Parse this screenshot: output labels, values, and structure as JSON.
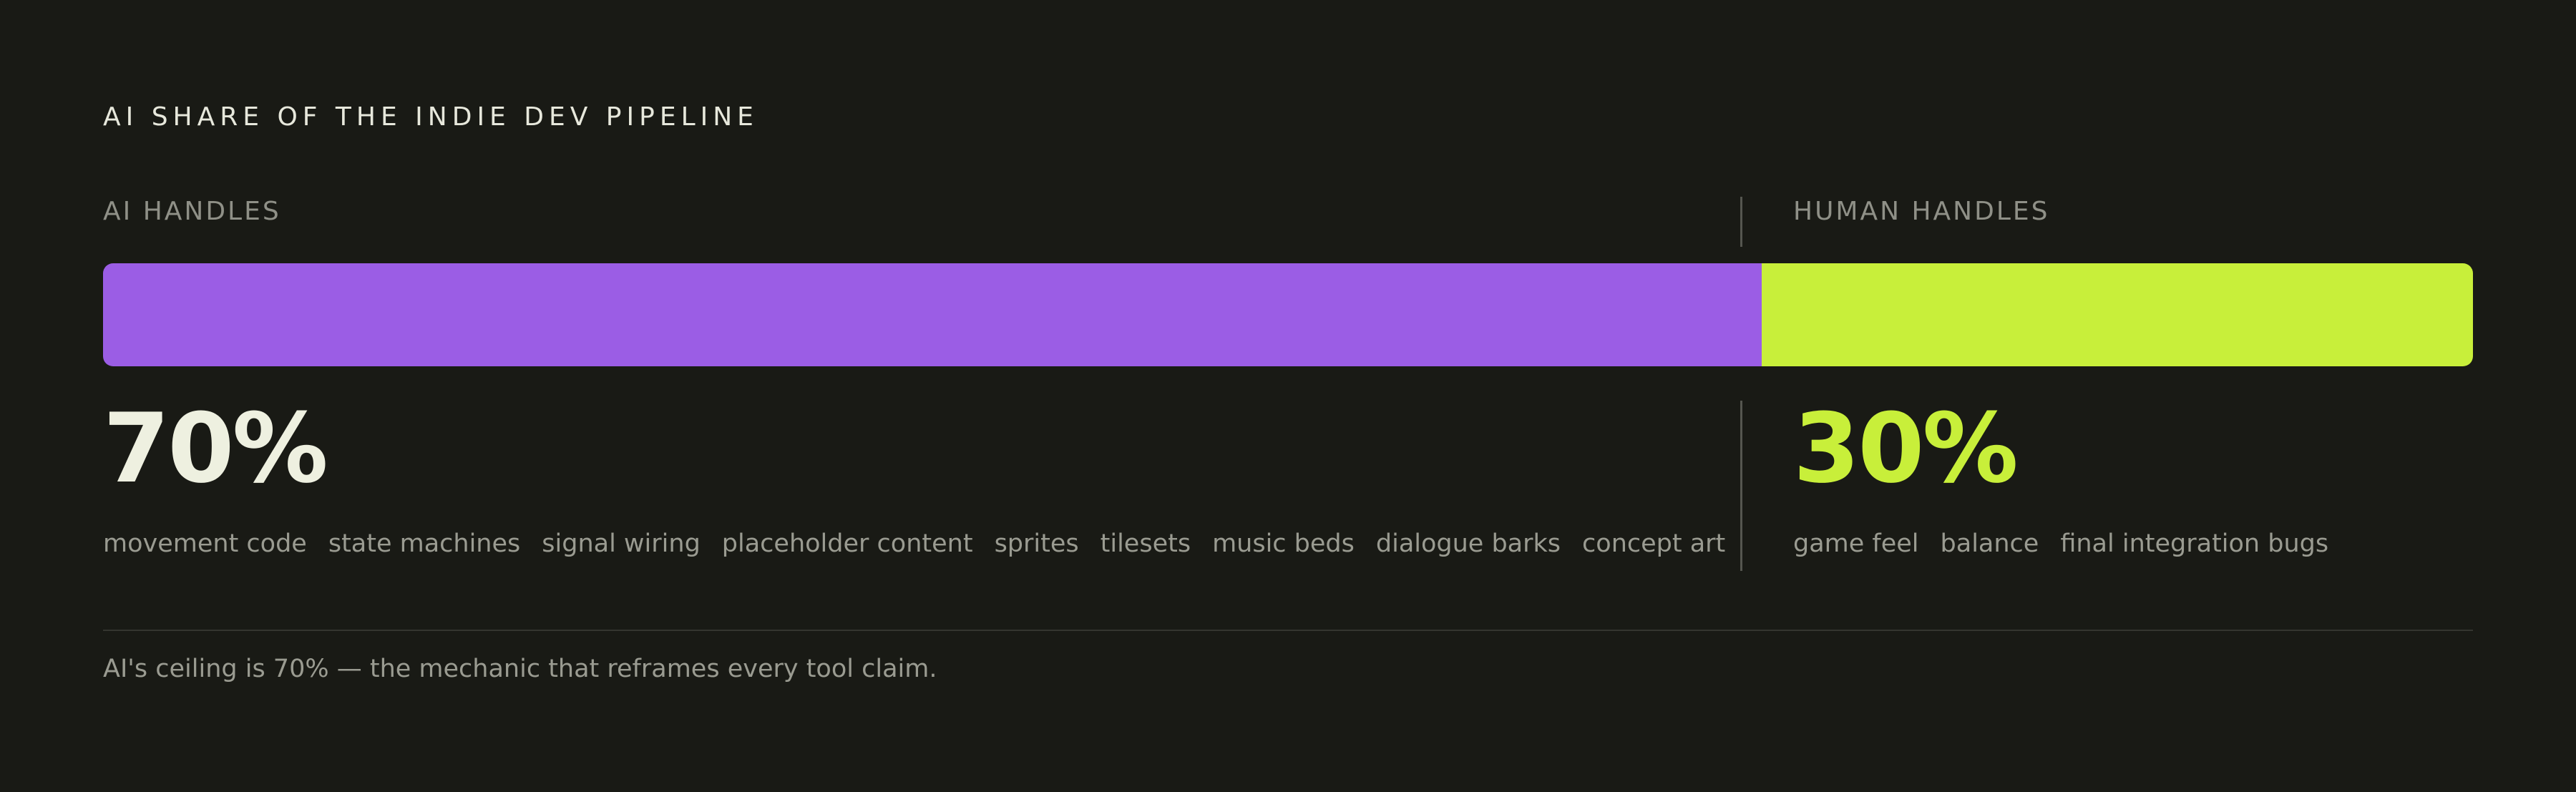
{
  "chart_data": {
    "type": "bar",
    "title": "AI SHARE OF THE INDIE DEV PIPELINE",
    "categories": [
      "AI HANDLES",
      "HUMAN HANDLES"
    ],
    "values": [
      70,
      30
    ],
    "value_labels": [
      "70%",
      "30%"
    ],
    "tasks": {
      "ai": [
        "movement code",
        "state machines",
        "signal wiring",
        "placeholder content",
        "sprites",
        "tilesets",
        "music beds",
        "dialogue barks",
        "concept art"
      ],
      "human": [
        "game feel",
        "balance",
        "final integration bugs"
      ]
    },
    "caption": "AI's ceiling is 70% — the mechanic that reframes every tool claim.",
    "colors": {
      "ai": "#9b5de5",
      "human": "#c8ef3a",
      "background": "#191a15"
    }
  }
}
